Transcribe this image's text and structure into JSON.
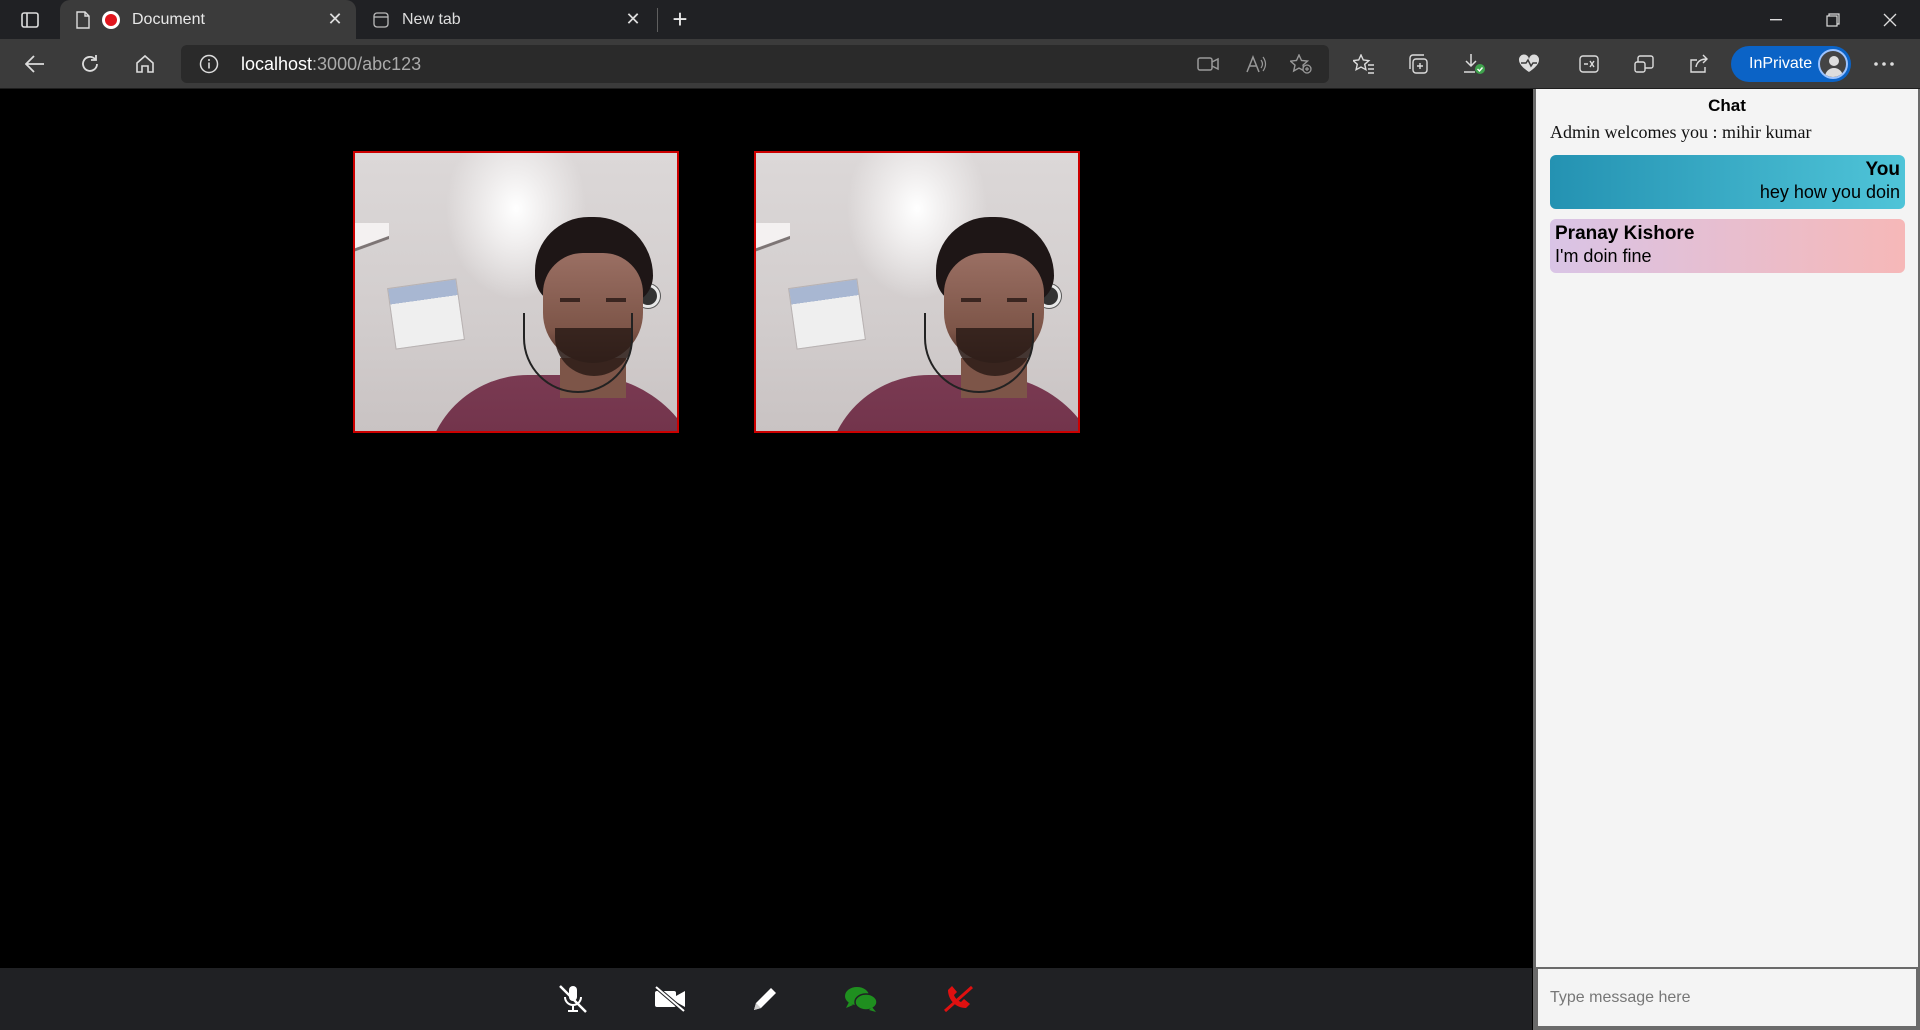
{
  "browser": {
    "tabs": [
      {
        "title": "Document",
        "active": true
      },
      {
        "title": "New tab",
        "active": false
      }
    ],
    "address": {
      "host": "localhost",
      "path": ":3000/abc123"
    },
    "inprivate_label": "InPrivate"
  },
  "meeting": {
    "videos": [
      {
        "name": "video-tile-1"
      },
      {
        "name": "video-tile-2"
      }
    ],
    "controls": [
      "mute-mic",
      "stop-video",
      "whiteboard",
      "chat",
      "leave-call"
    ],
    "colors": {
      "chat_icon": "#1f8f1f",
      "end_call": "#e01010",
      "video_border": "#cc0000"
    }
  },
  "chat": {
    "title": "Chat",
    "welcome": "Admin welcomes you : mihir kumar",
    "messages": [
      {
        "sender": "You",
        "text": "hey how you doin"
      },
      {
        "sender": "Pranay Kishore",
        "text": "I'm doin fine"
      }
    ],
    "input_placeholder": "Type message here"
  }
}
